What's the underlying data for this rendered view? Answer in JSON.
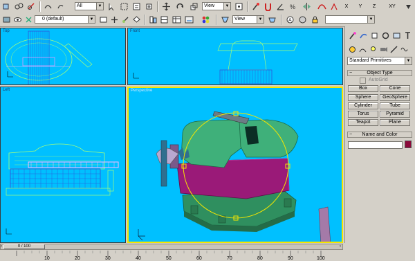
{
  "toolbar": {
    "selection_filter": "All",
    "reference_coord": "View",
    "axis_labels": [
      "X",
      "Y",
      "Z",
      "XY"
    ],
    "named_selection": "",
    "colors": {
      "viewport_bg": "#00c0ff",
      "active_border": "#f5e600"
    }
  },
  "layer_bar": {
    "layer_name": "0 (default)",
    "view_dropdown": "View"
  },
  "viewports": {
    "top_left_label": "Top",
    "top_right_label": "Front",
    "bottom_left_label": "Left",
    "perspective_label": "Perspective"
  },
  "command_panel": {
    "category": "Standard Primitives",
    "object_type_title": "Object Type",
    "autogrid_label": "AutoGrid",
    "primitives": [
      "Box",
      "Cone",
      "Sphere",
      "GeoSphere",
      "Cylinder",
      "Tube",
      "Torus",
      "Pyramid",
      "Teapot",
      "Plane"
    ],
    "name_color_title": "Name and Color",
    "name_value": "",
    "object_color": "#8b0a3a"
  },
  "timeline": {
    "frame_display": "0 / 100",
    "ticks": [
      "10",
      "20",
      "30",
      "40",
      "50",
      "60",
      "70",
      "80",
      "90",
      "100"
    ]
  }
}
